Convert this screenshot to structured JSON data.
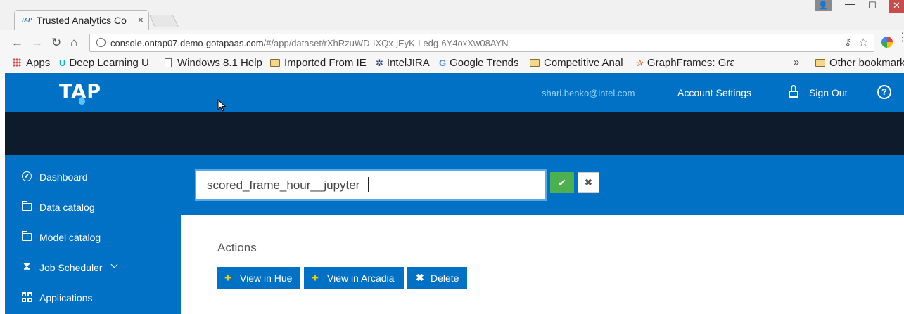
{
  "browser": {
    "tab": {
      "title": "Trusted Analytics Console",
      "favicon": "TAP"
    },
    "window_controls": {
      "minimize": "—",
      "maximize": "☐",
      "close": "✕"
    },
    "address": {
      "url_host": "console.ontap07.demo-gotapaas.com",
      "url_path": "/#/app/dataset/rXhRzuWD-IXQx-jEyK-Ledg-6Y4oxXw08AYN"
    },
    "bookmarks": [
      {
        "label": "Apps",
        "icon": "apps-icon"
      },
      {
        "label": "Deep Learning U",
        "icon": "udacity-icon"
      },
      {
        "label": "Windows 8.1 Help",
        "icon": "document-icon"
      },
      {
        "label": "Imported From IE",
        "icon": "folder-icon"
      },
      {
        "label": "IntelJIRA",
        "icon": "jira-icon"
      },
      {
        "label": "Google Trends",
        "icon": "google-icon"
      },
      {
        "label": "Competitive Anal",
        "icon": "folder-icon"
      },
      {
        "label": "GraphFrames: Gra",
        "icon": "spark-icon"
      }
    ],
    "bookmarks_overflow": "»",
    "other_bookmarks": "Other bookmarks"
  },
  "header": {
    "logo": "TAP",
    "user_email": "shari.benko@intel.com",
    "account_settings": "Account Settings",
    "sign_out": "Sign Out",
    "help": "?"
  },
  "sidebar": {
    "items": [
      {
        "label": "Dashboard",
        "icon": "dashboard-icon"
      },
      {
        "label": "Data catalog",
        "icon": "folder-icon"
      },
      {
        "label": "Model catalog",
        "icon": "folder-icon"
      },
      {
        "label": "Job Scheduler",
        "icon": "hourglass-icon",
        "expandable": true
      },
      {
        "label": "Applications",
        "icon": "grid-icon"
      }
    ]
  },
  "editor": {
    "name_value": "scored_frame_hour__jupyter",
    "confirm_icon": "✔",
    "cancel_icon": "✖"
  },
  "actions": {
    "title": "Actions",
    "buttons": [
      {
        "label": "View in Hue",
        "icon": "plus-icon"
      },
      {
        "label": "View in Arcadia",
        "icon": "plus-icon"
      },
      {
        "label": "Delete",
        "icon": "x-icon"
      }
    ]
  },
  "colors": {
    "brand_blue": "#0071c5",
    "dark_band": "#0e1b2c",
    "confirm_green": "#4caf50",
    "plus_yellow": "#f5d400"
  }
}
